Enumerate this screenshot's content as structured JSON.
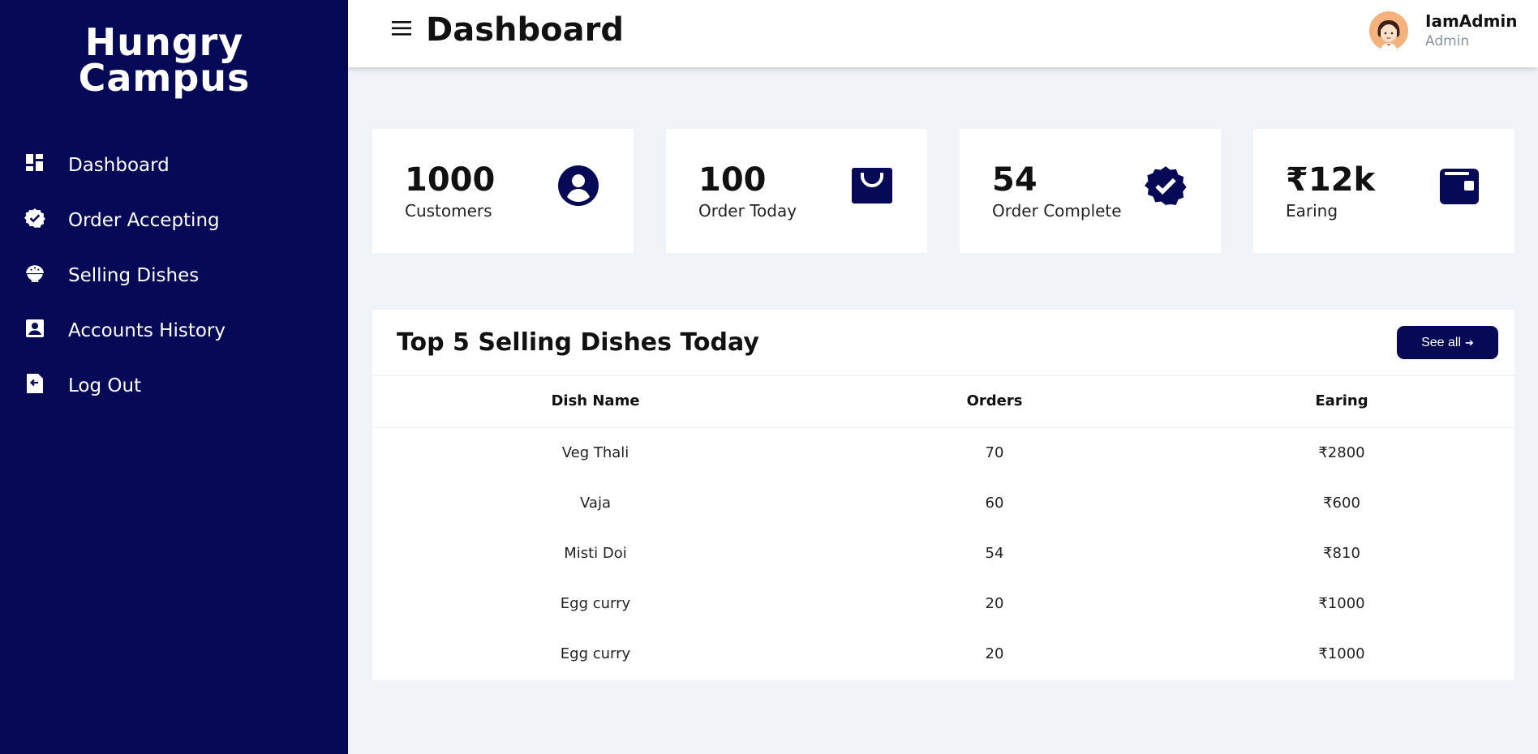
{
  "brand": {
    "line1": "Hungry",
    "line2": "Campus"
  },
  "sidebar": {
    "items": [
      {
        "label": "Dashboard",
        "icon": "dashboard-icon"
      },
      {
        "label": "Order Accepting",
        "icon": "verified-badge-icon"
      },
      {
        "label": "Selling Dishes",
        "icon": "rice-bowl-icon"
      },
      {
        "label": "Accounts History",
        "icon": "account-box-icon"
      },
      {
        "label": "Log Out",
        "icon": "logout-icon"
      }
    ]
  },
  "header": {
    "title": "Dashboard",
    "user": {
      "name": "IamAdmin",
      "role": "Admin"
    }
  },
  "cards": [
    {
      "value": "1000",
      "label": "Customers",
      "icon": "user-circle-icon"
    },
    {
      "value": "100",
      "label": "Order Today",
      "icon": "shopping-bag-icon"
    },
    {
      "value": "54",
      "label": "Order Complete",
      "icon": "verified-check-icon"
    },
    {
      "value": "₹12k",
      "label": "Earing",
      "icon": "wallet-icon"
    }
  ],
  "table": {
    "title": "Top 5 Selling Dishes Today",
    "see_all_label": "See all",
    "headers": [
      "Dish Name",
      "Orders",
      "Earing"
    ],
    "rows": [
      [
        "Veg Thali",
        "70",
        "₹2800"
      ],
      [
        "Vaja",
        "60",
        "₹600"
      ],
      [
        "Misti Doi",
        "54",
        "₹810"
      ],
      [
        "Egg curry",
        "20",
        "₹1000"
      ],
      [
        "Egg curry",
        "20",
        "₹1000"
      ]
    ]
  },
  "colors": {
    "primary": "#060a56",
    "background": "#f0f3f8",
    "card": "#ffffff"
  }
}
